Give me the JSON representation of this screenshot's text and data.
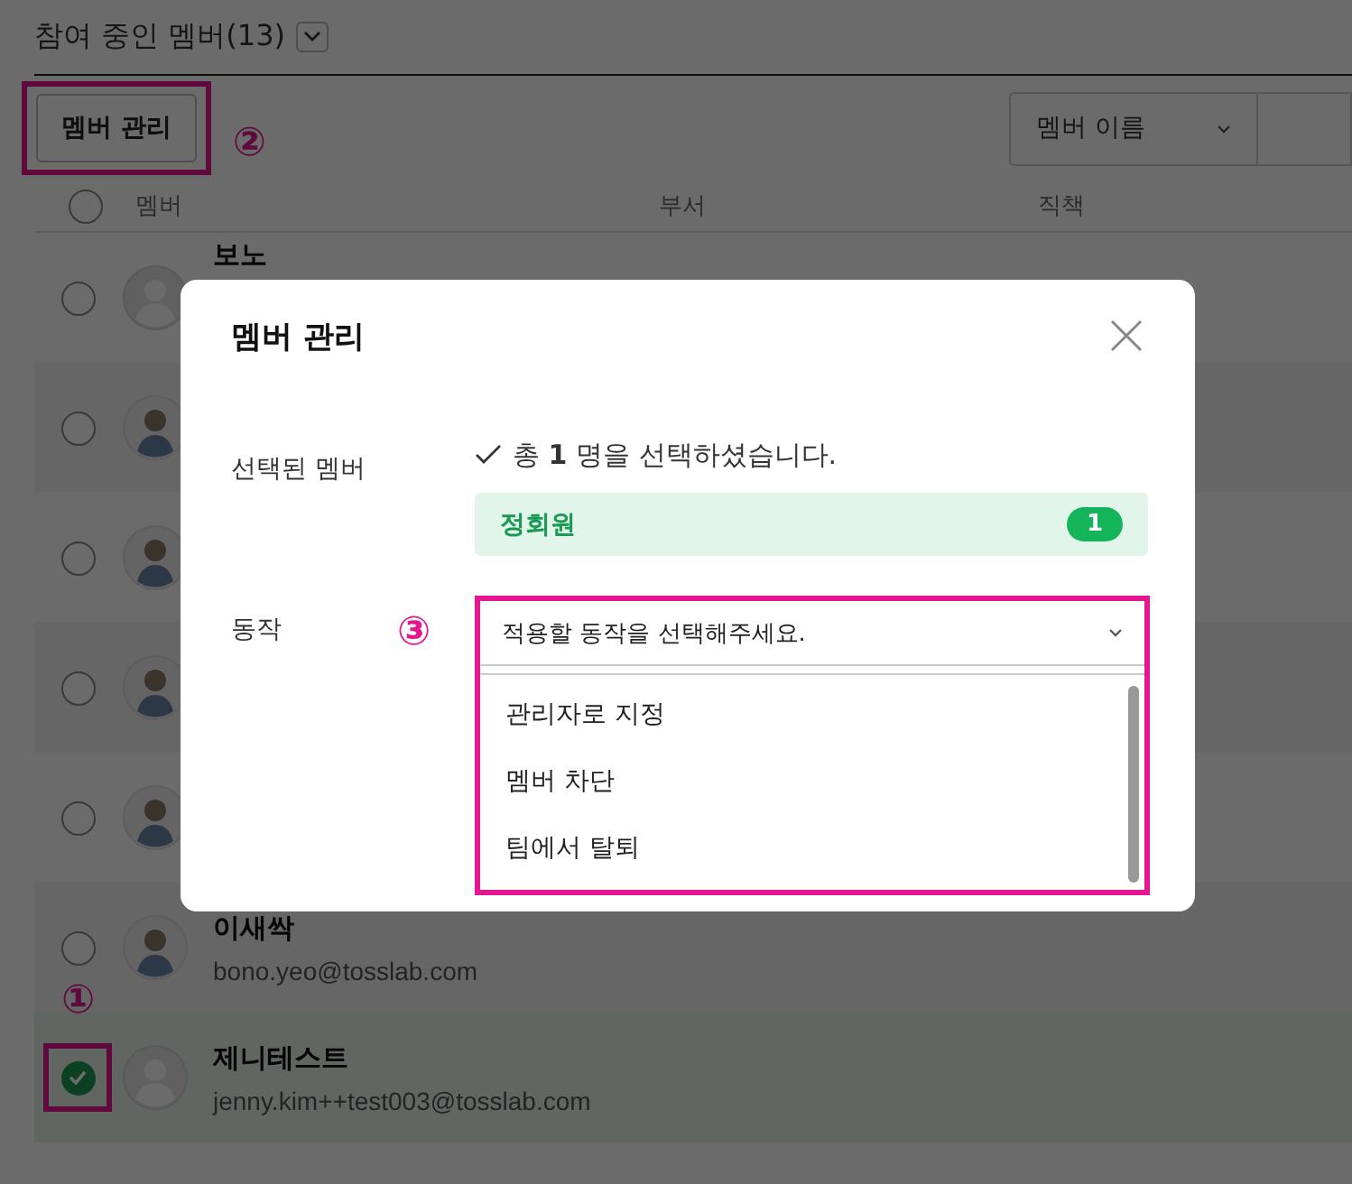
{
  "header": {
    "title": "참여 중인 멤버(13)"
  },
  "toolbar": {
    "manage_button": "멤버 관리",
    "annotation": "②",
    "sort_select": "멤버 이름"
  },
  "table": {
    "select_all": {
      "checked": false
    },
    "columns": [
      "멤버",
      "부서",
      "직책"
    ],
    "rows": [
      {
        "name": "보노",
        "avatar": {
          "kind": "default"
        },
        "selected": false
      },
      {
        "avatar": {
          "kind": "illustration"
        },
        "selected": false
      },
      {
        "avatar": {
          "kind": "illustration"
        },
        "selected": false
      },
      {
        "avatar": {
          "kind": "illustration"
        },
        "selected": false
      },
      {
        "avatar": {
          "kind": "illustration"
        },
        "selected": false
      },
      {
        "name": "이새싹",
        "email": "bono.yeo@tosslab.com",
        "avatar": {
          "kind": "illustration"
        },
        "selected": false
      },
      {
        "name": "제니테스트",
        "email": "jenny.kim++test003@tosslab.com",
        "avatar": {
          "kind": "default"
        },
        "selected": true,
        "annotation": "①"
      }
    ]
  },
  "modal": {
    "title": "멤버 관리",
    "selected_label": "선택된 멤버",
    "summary": "총 **1** 명을 선택하셨습니다.",
    "group": {
      "name": "정회원",
      "count": "1"
    },
    "action_label": "동작",
    "annotation": "③",
    "action_select": {
      "placeholder": "적용할 동작을 선택해주세요.",
      "expanded": true,
      "options": [
        "관리자로 지정",
        "멤버 차단",
        "팀에서 탈퇴"
      ]
    }
  }
}
